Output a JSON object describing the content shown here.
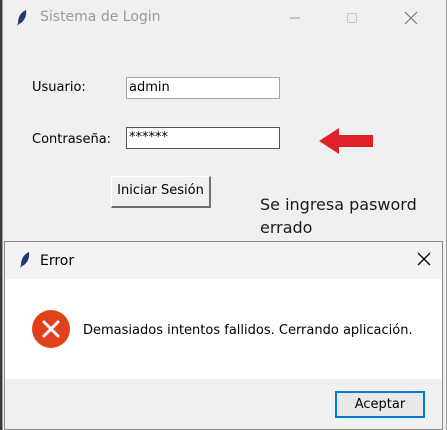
{
  "main_window": {
    "title": "Sistema de Login",
    "usuario_label": "Usuario:",
    "usuario_value": "admin",
    "password_label": "Contraseña:",
    "password_value": "******",
    "login_button": "Iniciar Sesión",
    "annotation": "Se ingresa pasword errado"
  },
  "error_dialog": {
    "title": "Error",
    "message": "Demasiados intentos fallidos. Cerrando aplicación.",
    "ok_button": "Aceptar"
  },
  "colors": {
    "arrow": "#e0202a",
    "error_icon": "#e0401a",
    "focus_border": "#0078d7"
  }
}
